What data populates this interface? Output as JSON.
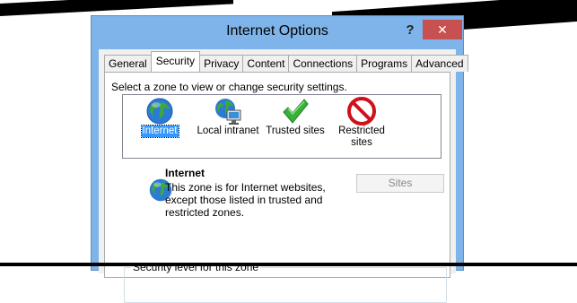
{
  "window": {
    "title": "Internet Options",
    "help_label": "?",
    "close_label": "✕",
    "accent_color": "#7eb4ea",
    "close_color": "#c75050"
  },
  "tabs": [
    {
      "label": "General"
    },
    {
      "label": "Security",
      "active": true
    },
    {
      "label": "Privacy"
    },
    {
      "label": "Content"
    },
    {
      "label": "Connections"
    },
    {
      "label": "Programs"
    },
    {
      "label": "Advanced"
    }
  ],
  "security": {
    "zone_prompt": "Select a zone to view or change security settings.",
    "zones": [
      {
        "label": "Internet",
        "icon": "globe-icon",
        "selected": true
      },
      {
        "label": "Local intranet",
        "icon": "intranet-globe-icon"
      },
      {
        "label": "Trusted sites",
        "icon": "checkmark-icon"
      },
      {
        "label_line1": "Restricted",
        "label_line2": "sites",
        "icon": "no-entry-icon"
      }
    ],
    "selected_zone_title": "Internet",
    "description_lines": [
      "This zone is for Internet websites,",
      "except those listed in trusted and",
      "restricted zones."
    ],
    "sites_button": "Sites",
    "security_level_group": "Security level for this zone"
  }
}
